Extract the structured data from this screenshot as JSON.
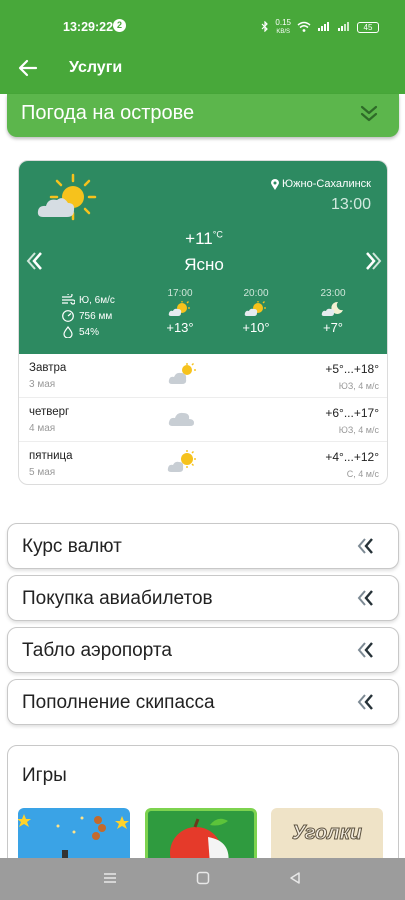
{
  "status_bar": {
    "time": "13:29:22",
    "notification_count": "2",
    "net_speed_value": "0.15",
    "net_speed_unit": "KB/S",
    "battery": "45"
  },
  "app_bar": {
    "title": "Услуги"
  },
  "weather_section": {
    "label": "Погода на острове",
    "location": "Южно-Сахалинск",
    "time": "13:00",
    "current_temp": "+11",
    "temp_unit": "°C",
    "condition": "Ясно",
    "wind": "Ю, 6м/с",
    "pressure": "756 мм",
    "humidity": "54%",
    "hourly": [
      {
        "time": "17:00",
        "temp": "+13°",
        "icon": "sun-cloud-icon"
      },
      {
        "time": "20:00",
        "temp": "+10°",
        "icon": "sun-cloud-icon"
      },
      {
        "time": "23:00",
        "temp": "+7°",
        "icon": "moon-cloud-icon"
      }
    ],
    "forecast": [
      {
        "day": "Завтра",
        "date": "3 мая",
        "range": "+5°...+18°",
        "wind": "ЮЗ, 4 м/с",
        "icon": "cloud-sun-icon"
      },
      {
        "day": "четверг",
        "date": "4 мая",
        "range": "+6°...+17°",
        "wind": "ЮЗ, 4 м/с",
        "icon": "cloud-icon"
      },
      {
        "day": "пятница",
        "date": "5 мая",
        "range": "+4°...+12°",
        "wind": "С, 4 м/с",
        "icon": "cloud-sun-icon"
      }
    ]
  },
  "services": [
    {
      "label": "Курс валют"
    },
    {
      "label": "Покупка авиабилетов"
    },
    {
      "label": "Табло аэропорта"
    },
    {
      "label": "Пополнение скипасса"
    }
  ],
  "games": {
    "title": "Игры",
    "tiles": [
      {
        "title": ""
      },
      {
        "title": ""
      },
      {
        "title": "Уголки"
      }
    ]
  },
  "colors": {
    "app_green": "#48a83a",
    "section_green": "#5cb64c",
    "weather_teal": "#2d8a61"
  }
}
